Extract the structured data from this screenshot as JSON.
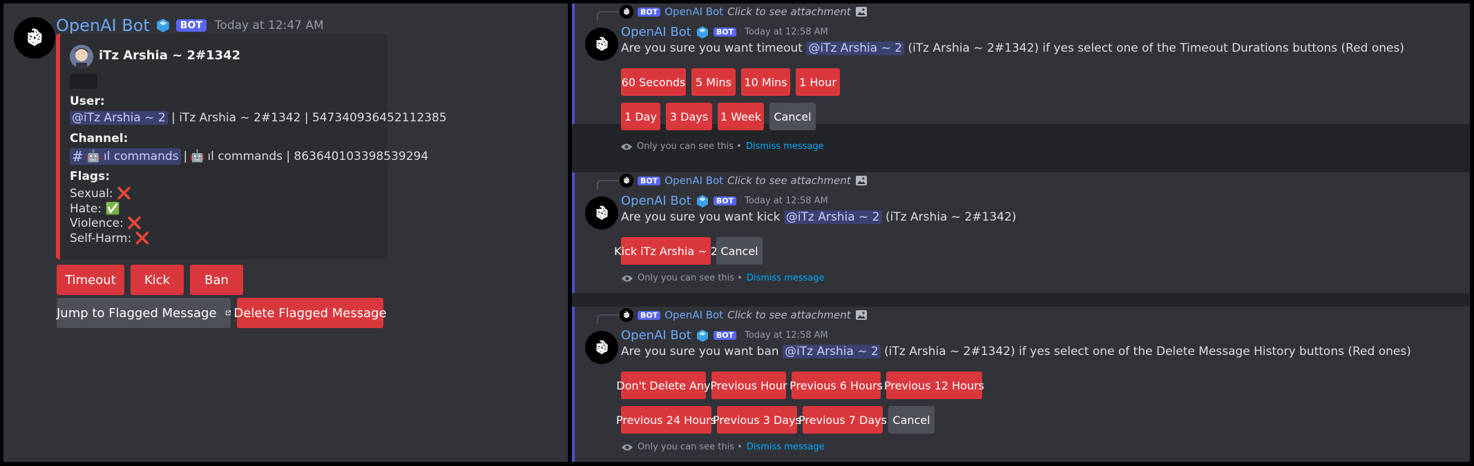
{
  "left": {
    "bot_name": "OpenAI Bot",
    "bot_tag": "BOT",
    "timestamp": "Today at 12:47 AM",
    "embed": {
      "author": "iTz Arshia ~ 2#1342",
      "user_label": "User:",
      "user_mention": "@iTz Arshia ~ 2",
      "user_rest": "| iTz Arshia ~ 2#1342 | 547340936452112385",
      "channel_label": "Channel:",
      "channel_mention": "ıl commands",
      "channel_rest": "ıl commands | 863640103398539294",
      "flags_label": "Flags:",
      "flags": [
        {
          "label": "Sexual:",
          "value": "❌"
        },
        {
          "label": "Hate:",
          "value": "✅"
        },
        {
          "label": "Violence:",
          "value": "❌"
        },
        {
          "label": "Self-Harm:",
          "value": "❌"
        }
      ],
      "accent_color": "#da373c"
    },
    "buttons_row1": [
      "Timeout",
      "Kick",
      "Ban"
    ],
    "jump_button": "Jump to Flagged Message",
    "delete_button": "Delete Flagged Message"
  },
  "right": {
    "reply_name": "OpenAI Bot",
    "reply_text": "Click to see attachment",
    "bot_name": "OpenAI Bot",
    "bot_tag": "BOT",
    "ephemeral_note": "Only you can see this •",
    "dismiss": "Dismiss message",
    "timeout": {
      "timestamp": "Today at 12:58 AM",
      "text_before": "Are you sure you want timeout",
      "mention": "@iTz Arshia ~ 2",
      "text_after": "(iTz Arshia ~ 2#1342) if yes select one of the Timeout Durations buttons (Red ones)",
      "row1": [
        "60 Seconds",
        "5 Mins",
        "10 Mins",
        "1 Hour"
      ],
      "row2": [
        "1 Day",
        "3 Days",
        "1 Week"
      ],
      "cancel": "Cancel"
    },
    "kick": {
      "timestamp": "Today at 12:58 AM",
      "text_before": "Are you sure you want kick",
      "mention": "@iTz Arshia ~ 2",
      "text_after": "(iTz Arshia ~ 2#1342)",
      "kick_button": "Kick iTz Arshia ~ 2",
      "cancel": "Cancel"
    },
    "ban": {
      "timestamp": "Today at 12:58 AM",
      "text_before": "Are you sure you want ban",
      "mention": "@iTz Arshia ~ 2",
      "text_after": "(iTz Arshia ~ 2#1342) if yes select one of the Delete Message History buttons (Red ones)",
      "row1": [
        "Don't Delete Any",
        "Previous Hour",
        "Previous 6 Hours",
        "Previous 12 Hours"
      ],
      "row2": [
        "Previous 24 Hours",
        "Previous 3 Days",
        "Previous 7 Days"
      ],
      "cancel": "Cancel"
    }
  }
}
